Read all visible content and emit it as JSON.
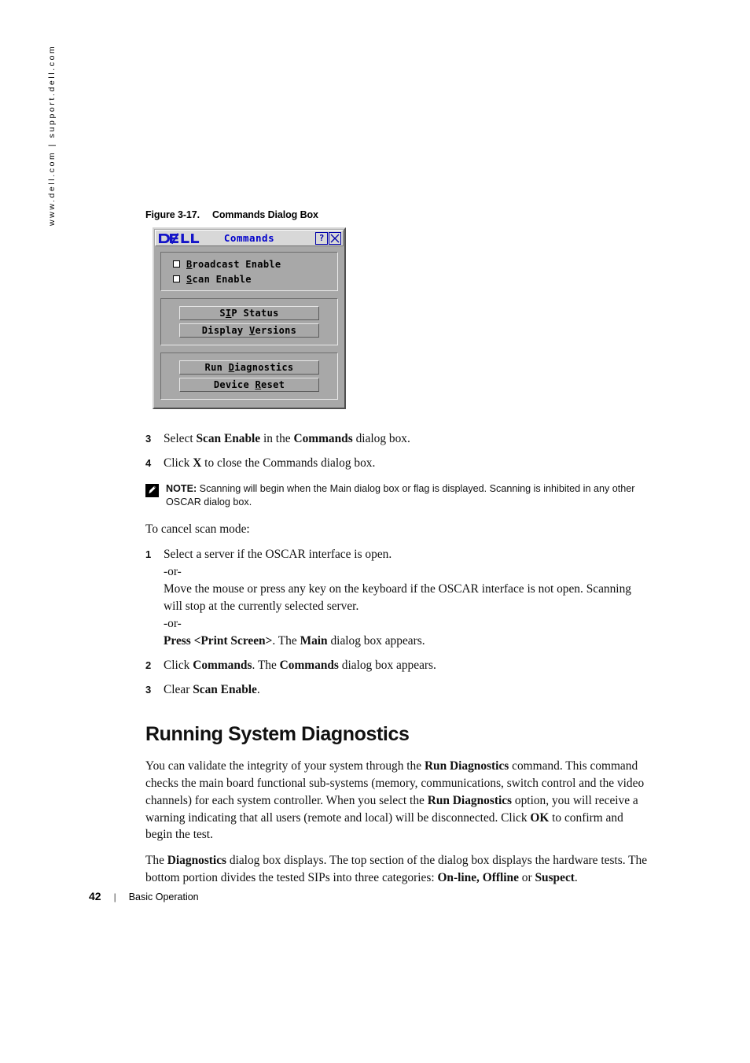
{
  "side_url": "www.dell.com | support.dell.com",
  "figure": {
    "number": "Figure 3-17.",
    "title": "Commands Dialog Box"
  },
  "dialog": {
    "logo": "dell-logo",
    "title": "Commands",
    "help_button": "?",
    "close_button": "X",
    "checkboxes": [
      {
        "label_pre": "",
        "mnemonic": "B",
        "label_post": "roadcast Enable",
        "checked": false,
        "full": "Broadcast Enable"
      },
      {
        "label_pre": "",
        "mnemonic": "S",
        "label_post": "can Enable",
        "checked": false,
        "full": "Scan Enable"
      }
    ],
    "group2_buttons": [
      {
        "pre": "S",
        "mnemonic": "I",
        "post": "P Status",
        "full": "SIP Status"
      },
      {
        "pre": "Display ",
        "mnemonic": "V",
        "post": "ersions",
        "full": "Display Versions"
      }
    ],
    "group3_buttons": [
      {
        "pre": "Run ",
        "mnemonic": "D",
        "post": "iagnostics",
        "full": "Run Diagnostics"
      },
      {
        "pre": "Device ",
        "mnemonic": "R",
        "post": "eset",
        "full": "Device Reset"
      }
    ]
  },
  "steps_top": [
    {
      "num": "3",
      "parts": [
        {
          "t": "Select ",
          "b": false
        },
        {
          "t": "Scan Enable",
          "b": true
        },
        {
          "t": " in the ",
          "b": false
        },
        {
          "t": "Commands",
          "b": true
        },
        {
          "t": " dialog box.",
          "b": false
        }
      ]
    },
    {
      "num": "4",
      "parts": [
        {
          "t": "Click ",
          "b": false
        },
        {
          "t": "X",
          "b": true
        },
        {
          "t": " to close the Commands dialog box.",
          "b": false
        }
      ]
    }
  ],
  "note": {
    "icon": "note-pencil-icon",
    "label": "NOTE:",
    "text": " Scanning will begin when the Main dialog box or flag is displayed. Scanning is inhibited in any other OSCAR dialog box."
  },
  "cancel_intro": "To cancel scan mode:",
  "steps_cancel": [
    {
      "num": "1",
      "lines": [
        [
          {
            "t": "Select a server if the OSCAR interface is open.",
            "b": false
          }
        ],
        [
          {
            "t": "-or-",
            "b": false
          }
        ],
        [
          {
            "t": "Move the mouse or press any key on the keyboard if the OSCAR interface is not open. Scanning will stop at the currently selected server.",
            "b": false
          }
        ],
        [
          {
            "t": "-or-",
            "b": false
          }
        ],
        [
          {
            "t": "Press <Print Screen>",
            "b": true
          },
          {
            "t": ". The ",
            "b": false
          },
          {
            "t": "Main",
            "b": true
          },
          {
            "t": " dialog box appears.",
            "b": false
          }
        ]
      ]
    },
    {
      "num": "2",
      "lines": [
        [
          {
            "t": "Click ",
            "b": false
          },
          {
            "t": "Commands",
            "b": true
          },
          {
            "t": ". The ",
            "b": false
          },
          {
            "t": "Commands",
            "b": true
          },
          {
            "t": " dialog box appears.",
            "b": false
          }
        ]
      ]
    },
    {
      "num": "3",
      "lines": [
        [
          {
            "t": "Clear ",
            "b": false
          },
          {
            "t": "Scan Enable",
            "b": true
          },
          {
            "t": ".",
            "b": false
          }
        ]
      ]
    }
  ],
  "section": {
    "heading": "Running System Diagnostics",
    "paragraphs": [
      [
        {
          "t": "You can validate the integrity of your system through the ",
          "b": false
        },
        {
          "t": "Run Diagnostics",
          "b": true
        },
        {
          "t": " command. This command checks the main board functional sub-systems (memory, communications, switch control and the video channels) for each system controller. When you select the ",
          "b": false
        },
        {
          "t": "Run Diagnostics",
          "b": true
        },
        {
          "t": " option, you will receive a warning indicating that all users (remote and local) will be disconnected. Click ",
          "b": false
        },
        {
          "t": "OK",
          "b": true
        },
        {
          "t": " to confirm and begin the test.",
          "b": false
        }
      ],
      [
        {
          "t": "The ",
          "b": false
        },
        {
          "t": "Diagnostics",
          "b": true
        },
        {
          "t": " dialog box displays. The top section of the dialog box displays the hardware tests. The bottom portion divides the tested SIPs into three categories: ",
          "b": false
        },
        {
          "t": "On-line, Offline",
          "b": true
        },
        {
          "t": " or ",
          "b": false
        },
        {
          "t": "Suspect",
          "b": true
        },
        {
          "t": ".",
          "b": false
        }
      ]
    ]
  },
  "footer": {
    "page": "42",
    "separator": "|",
    "chapter": "Basic Operation"
  },
  "colors": {
    "dell_blue": "#0000cc",
    "dialog_face": "#a8a8a8",
    "titlebar_face": "#d8d8d8"
  }
}
